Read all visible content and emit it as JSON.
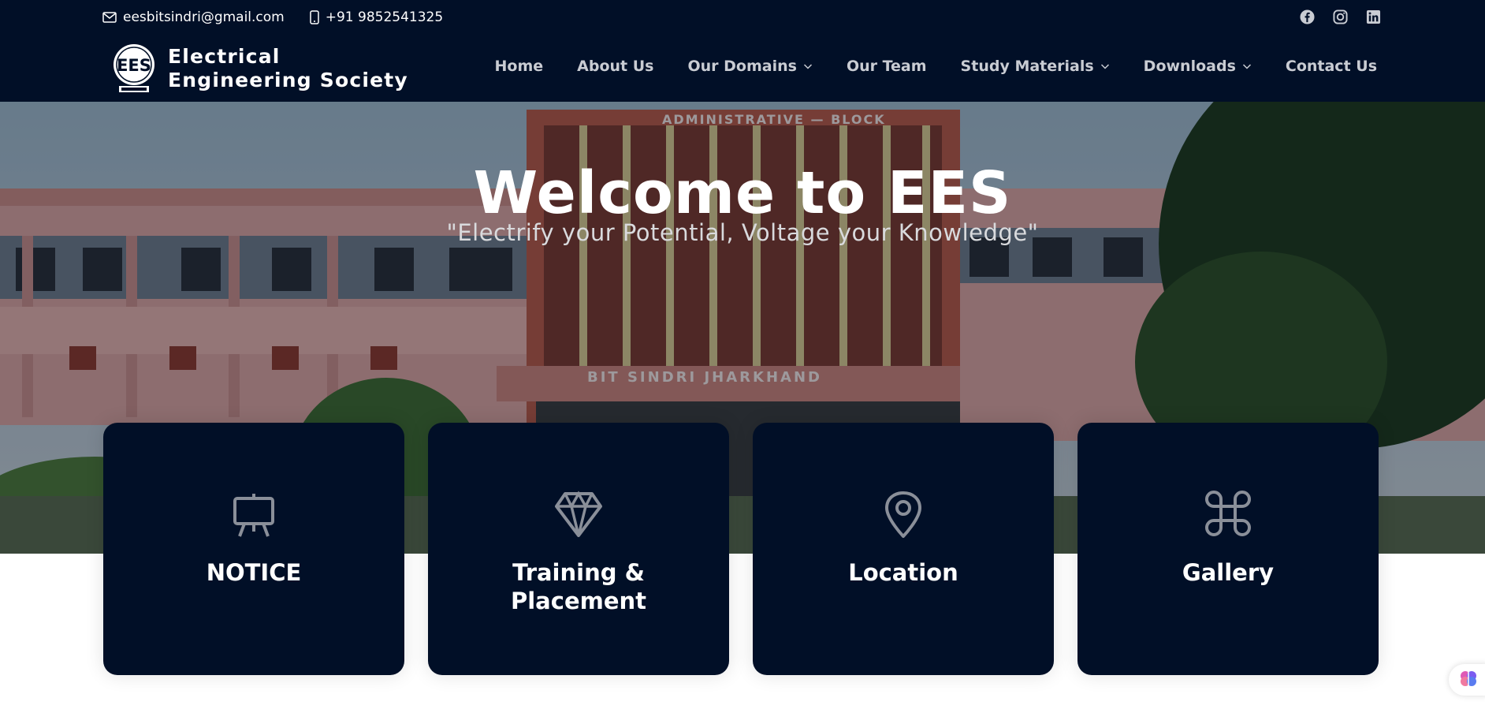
{
  "contact": {
    "email": "eesbitsindri@gmail.com",
    "phone": "+91 9852541325"
  },
  "socials": [
    {
      "icon": "facebook-icon"
    },
    {
      "icon": "instagram-icon"
    },
    {
      "icon": "linkedin-icon"
    }
  ],
  "brand": {
    "name": "Electrical Engineering Society",
    "logo_text": "EES"
  },
  "nav": {
    "home": "Home",
    "about": "About Us",
    "domains": "Our Domains",
    "team": "Our Team",
    "study": "Study Materials",
    "downloads": "Downloads",
    "contact": "Contact Us"
  },
  "hero": {
    "title": "Welcome to EES",
    "subtitle": "\"Electrify your Potential, Voltage your Knowledge\"",
    "building_sign_top": "ADMINISTRATIVE — BLOCK",
    "building_sign_bottom": "BIT SINDRI JHARKHAND"
  },
  "cards": [
    {
      "label": "NOTICE",
      "icon": "easel-icon"
    },
    {
      "label": "Training & Placement",
      "icon": "diamond-icon"
    },
    {
      "label": "Location",
      "icon": "map-pin-icon"
    },
    {
      "label": "Gallery",
      "icon": "command-icon"
    }
  ],
  "colors": {
    "navy": "#010f27",
    "icon_gray": "#8a8f99",
    "nav_text": "#c9ccd3"
  }
}
